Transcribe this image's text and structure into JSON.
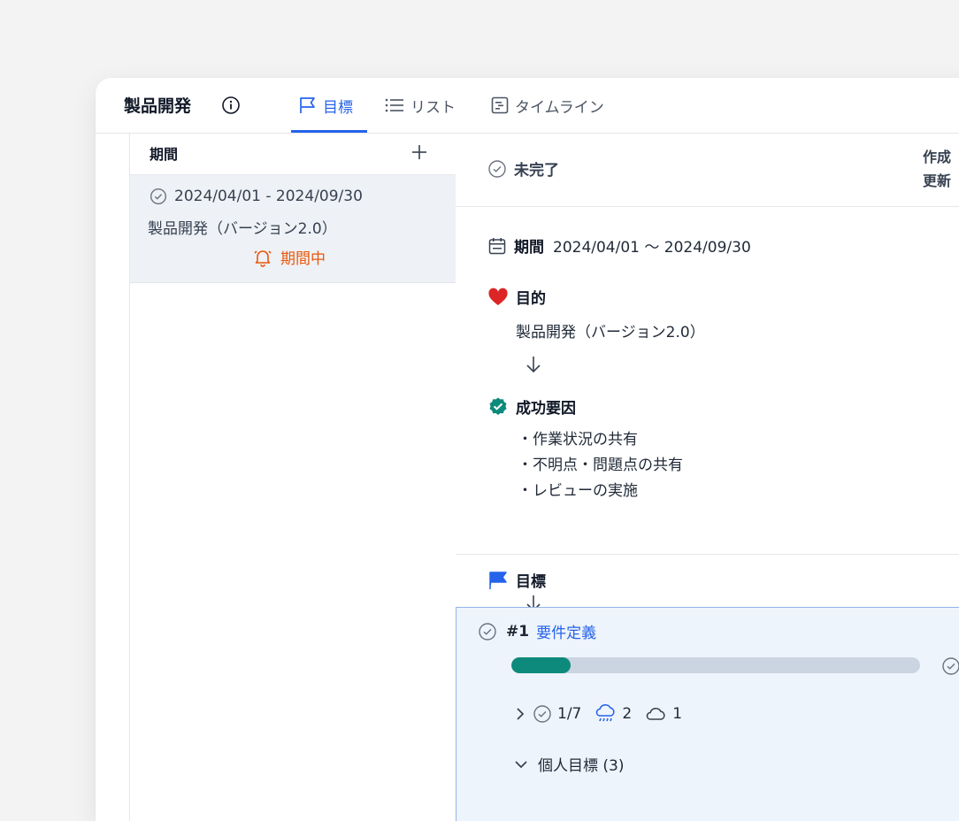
{
  "header": {
    "project_title": "製品開発",
    "tabs": [
      {
        "label": "目標",
        "active": true
      },
      {
        "label": "リスト",
        "active": false
      },
      {
        "label": "タイムライン",
        "active": false
      }
    ]
  },
  "sidebar": {
    "title": "期間",
    "periods": [
      {
        "range": "2024/04/01 - 2024/09/30",
        "name": "製品開発（バージョン2.0）",
        "status": "期間中"
      }
    ]
  },
  "detail": {
    "status": "未完了",
    "meta": {
      "created_label": "作成",
      "updated_label": "更新"
    },
    "period": {
      "label": "期間",
      "value": "2024/04/01 〜 2024/09/30"
    },
    "purpose": {
      "label": "目的",
      "text": "製品開発（バージョン2.0）"
    },
    "success_factors": {
      "label": "成功要因",
      "items": [
        "・作業状況の共有",
        "・不明点・問題点の共有",
        "・レビューの実施"
      ]
    },
    "goals": {
      "label": "目標",
      "items": [
        {
          "number": "#1",
          "title": "要件定義",
          "progress": 0.145,
          "tasks_done": "1/7",
          "rain_count": "2",
          "cloud_count": "1",
          "personal_goals_label": "個人目標 (3)"
        }
      ]
    }
  },
  "colors": {
    "accent": "#2563eb",
    "progress": "#0d8a7c",
    "warning": "#ea580c",
    "heart": "#dc2626",
    "success": "#0d8a7c"
  }
}
